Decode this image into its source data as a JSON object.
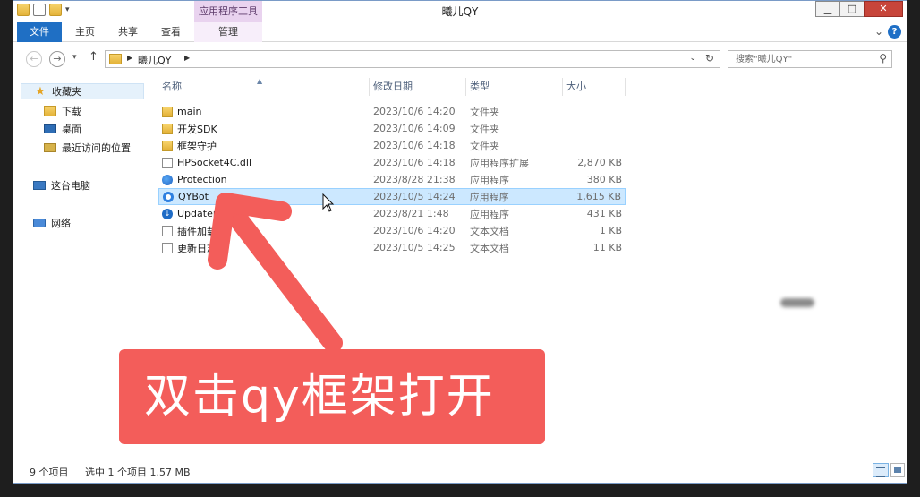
{
  "window": {
    "title": "曦儿QY",
    "tools_tab": "应用程序工具",
    "controls": {
      "minimize": "▁",
      "maximize": "□",
      "close": "✕"
    }
  },
  "ribbon": {
    "tabs": [
      {
        "id": "file",
        "label": "文件"
      },
      {
        "id": "home",
        "label": "主页"
      },
      {
        "id": "share",
        "label": "共享"
      },
      {
        "id": "view",
        "label": "查看"
      },
      {
        "id": "manage",
        "label": "管理"
      }
    ],
    "help": "?"
  },
  "address": {
    "path": "曦儿QY",
    "search_placeholder": "搜索\"曦儿QY\""
  },
  "navpane": {
    "items": [
      {
        "label": "收藏夹",
        "icon": "star-icon"
      },
      {
        "label": "下载",
        "icon": "download-folder-icon"
      },
      {
        "label": "桌面",
        "icon": "desktop-icon"
      },
      {
        "label": "最近访问的位置",
        "icon": "recent-places-icon"
      },
      {
        "label": "这台电脑",
        "icon": "computer-icon"
      },
      {
        "label": "网络",
        "icon": "network-icon"
      }
    ]
  },
  "columns": {
    "name": "名称",
    "date": "修改日期",
    "type": "类型",
    "size": "大小"
  },
  "files": [
    {
      "name": "main",
      "date": "2023/10/6 14:20",
      "type": "文件夹",
      "size": "",
      "icon": "folder-icon"
    },
    {
      "name": "开发SDK",
      "date": "2023/10/6 14:09",
      "type": "文件夹",
      "size": "",
      "icon": "folder-icon"
    },
    {
      "name": "框架守护",
      "date": "2023/10/6 14:18",
      "type": "文件夹",
      "size": "",
      "icon": "folder-icon"
    },
    {
      "name": "HPSocket4C.dll",
      "date": "2023/10/6 14:18",
      "type": "应用程序扩展",
      "size": "2,870 KB",
      "icon": "dll-icon"
    },
    {
      "name": "Protection",
      "date": "2023/8/28 21:38",
      "type": "应用程序",
      "size": "380 KB",
      "icon": "app-icon"
    },
    {
      "name": "QYBot",
      "date": "2023/10/5 14:24",
      "type": "应用程序",
      "size": "1,615 KB",
      "icon": "qybot-app-icon"
    },
    {
      "name": "Updater",
      "date": "2023/8/21 1:48",
      "type": "应用程序",
      "size": "431 KB",
      "icon": "updater-app-icon"
    },
    {
      "name": "插件加载",
      "date": "2023/10/6 14:20",
      "type": "文本文档",
      "size": "1 KB",
      "icon": "text-file-icon"
    },
    {
      "name": "更新日志",
      "date": "2023/10/5 14:25",
      "type": "文本文档",
      "size": "11 KB",
      "icon": "text-file-icon"
    }
  ],
  "selected_index": 5,
  "caption": "双击qy框架打开",
  "status": {
    "count": "9 个项目",
    "selected": "选中 1 个项目  1.57 MB"
  },
  "colors": {
    "accent": "#1f6fc4",
    "tools_tab": "#e9d3ef",
    "selection": "#cce8ff",
    "annotation_red": "#f35d5a"
  }
}
